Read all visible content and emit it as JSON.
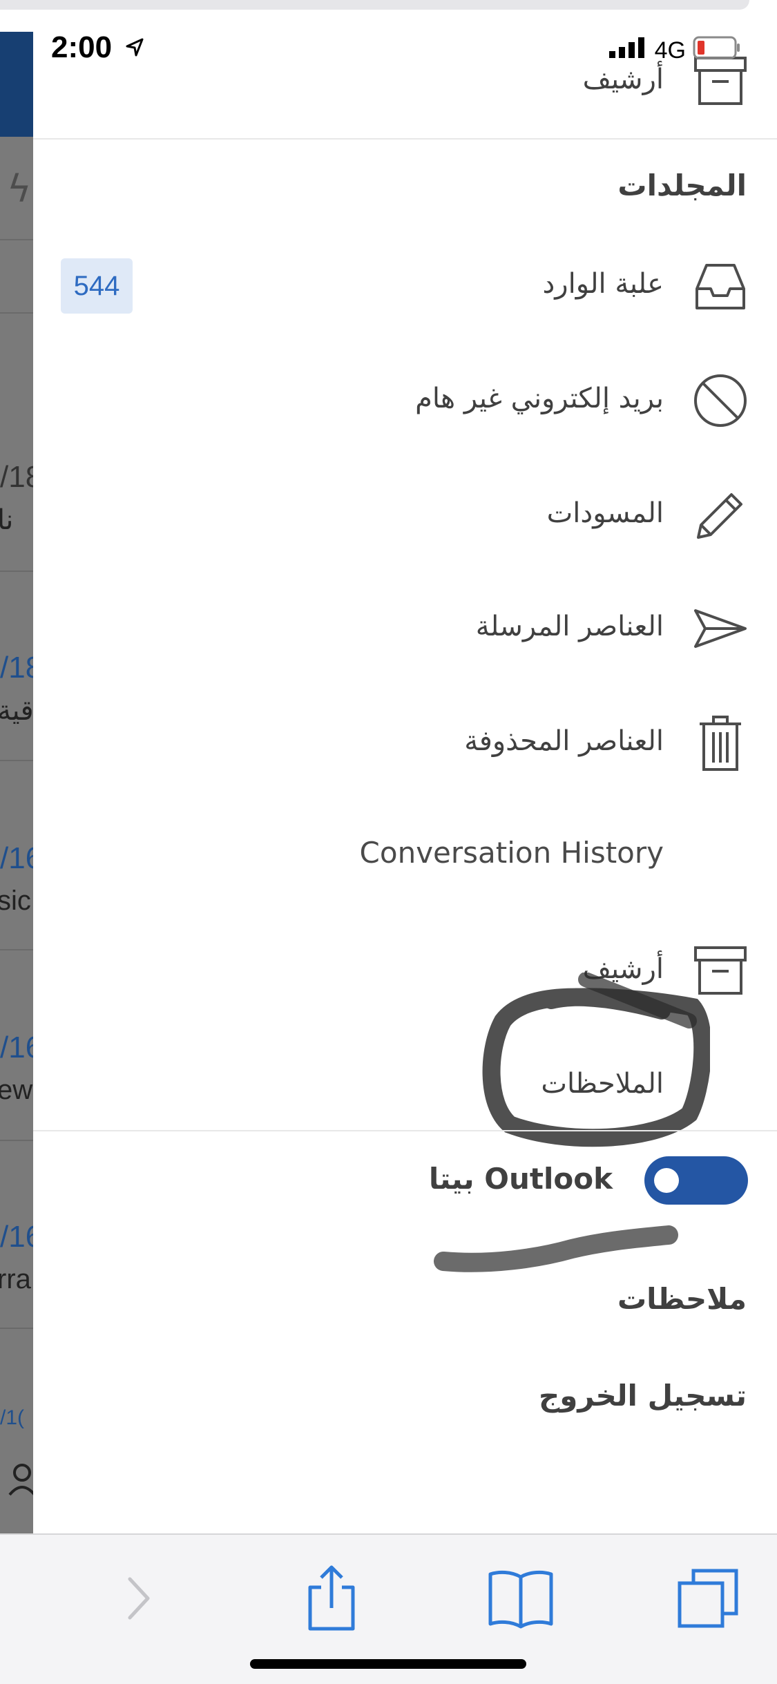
{
  "status_bar": {
    "time": "2:00",
    "network": "4G",
    "icons": [
      "location-arrow-icon",
      "signal-bars-icon",
      "battery-low-icon"
    ]
  },
  "background_list": {
    "rows": [
      {
        "date": "/18",
        "snippet": "نا"
      },
      {
        "date": "/18",
        "snippet": "قية"
      },
      {
        "date": "/16",
        "snippet": "sic"
      },
      {
        "date": "/16",
        "snippet": "ew"
      },
      {
        "date": "/16",
        "snippet": "rra"
      },
      {
        "date": "/1("
      }
    ]
  },
  "drawer": {
    "top_item": {
      "label": "أرشيف",
      "icon": "archive-icon"
    },
    "folders_heading": "المجلدات",
    "folders": [
      {
        "label": "علبة الوارد",
        "icon": "inbox-tray-icon",
        "count": "544"
      },
      {
        "label": "بريد إلكتروني غير هام",
        "icon": "blocked-icon"
      },
      {
        "label": "المسودات",
        "icon": "pencil-icon"
      },
      {
        "label": "العناصر المرسلة",
        "icon": "paper-plane-icon"
      },
      {
        "label": "العناصر المحذوفة",
        "icon": "trash-icon"
      },
      {
        "label": "Conversation History"
      },
      {
        "label": "أرشيف",
        "icon": "archive-icon"
      },
      {
        "label": "الملاحظات"
      }
    ],
    "beta_toggle": {
      "label": "Outlook بيتا",
      "on": true
    },
    "notes_link": "ملاحظات",
    "sign_out": "تسجيل الخروج"
  },
  "colors": {
    "accent": "#2456a4",
    "badge_bg": "#dfe9f7",
    "badge_text": "#2e6bc1",
    "toolbar_icon": "#2f7bd9",
    "toolbar_icon_disabled": "#c4c4c8"
  },
  "toolbar": {
    "buttons": [
      "forward-chevron-icon",
      "share-icon",
      "bookmarks-icon",
      "tabs-icon"
    ]
  }
}
